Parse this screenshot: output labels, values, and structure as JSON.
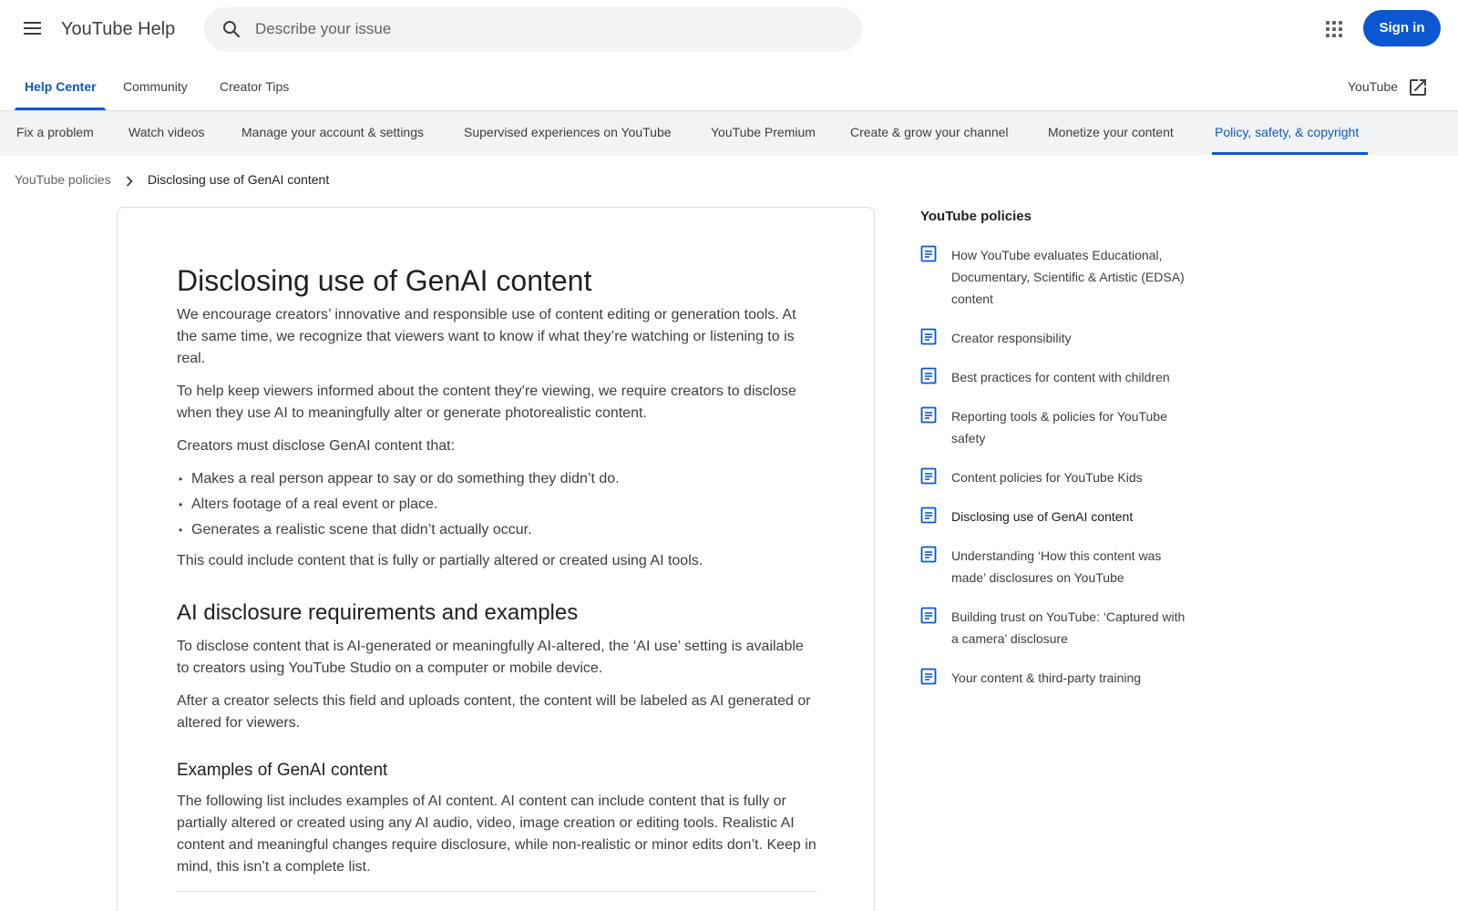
{
  "header": {
    "product_name": "YouTube Help",
    "search_placeholder": "Describe your issue",
    "signin_label": "Sign in"
  },
  "tabs": {
    "items": [
      "Help Center",
      "Community",
      "Creator Tips"
    ],
    "active": "Help Center",
    "external_link": "YouTube"
  },
  "categories": {
    "items": [
      "Fix a problem",
      "Watch videos",
      "Manage your account & settings",
      "Supervised experiences on YouTube",
      "YouTube Premium",
      "Create & grow your channel",
      "Monetize your content",
      "Policy, safety, & copyright"
    ],
    "active": "Policy, safety, & copyright"
  },
  "breadcrumb": {
    "parent": "YouTube policies",
    "current": "Disclosing use of GenAI content"
  },
  "article": {
    "title": "Disclosing use of GenAI content",
    "intro_1": "We encourage creators’ innovative and responsible use of content editing or generation tools. At the same time, we recognize that viewers want to know if what they’re watching or listening to is real.",
    "intro_2": "To help keep viewers informed about the content they're viewing, we require creators to disclose when they use AI to meaningfully alter or generate photorealistic content.",
    "intro_3": "Creators must disclose GenAI content that:",
    "bullets": [
      "Makes a real person appear to say or do something they didn’t do.",
      "Alters footage of a real event or place.",
      "Generates a realistic scene that didn’t actually occur."
    ],
    "intro_4": "This could include content that is fully or partially altered or created using AI tools.",
    "section_heading": "AI disclosure requirements and examples",
    "section_p1": "To disclose content that is AI-generated or meaningfully AI-altered, the ‘AI use’ setting is available to creators using YouTube Studio on a computer or mobile device.",
    "section_p2": "After a creator selects this field and uploads content, the content will be labeled as AI generated or altered for viewers.",
    "sub_heading": "Examples of GenAI content",
    "sub_p1": "The following list includes examples of AI content. AI content can include content that is fully or partially altered or created using any AI audio, video, image creation or editing tools. Realistic AI content and meaningful changes require disclosure, while non-realistic or minor edits don’t. Keep in mind, this isn’t a complete list."
  },
  "sidebar": {
    "title": "YouTube policies",
    "items": [
      "How YouTube evaluates Educational, Documentary, Scientific & Artistic (EDSA) content",
      "Creator responsibility",
      "Best practices for content with children",
      "Reporting tools & policies for YouTube safety",
      "Content policies for YouTube Kids",
      "Disclosing use of GenAI content",
      "Understanding ‘How this content was made’ disclosures on YouTube",
      "Building trust on YouTube: ‘Captured with a camera’ disclosure",
      "Your content & third-party training"
    ],
    "current": "Disclosing use of GenAI content"
  },
  "icons": {
    "menu": "hamburger-menu-icon",
    "search": "search-icon",
    "apps": "apps-grid-icon",
    "external": "open-in-new-icon",
    "breadcrumb_sep": "chevron-right-icon",
    "doc": "article-icon"
  },
  "colors": {
    "accent": "#0b57d0",
    "nav_bg": "#f1f3f4",
    "text": "#3c4043"
  }
}
